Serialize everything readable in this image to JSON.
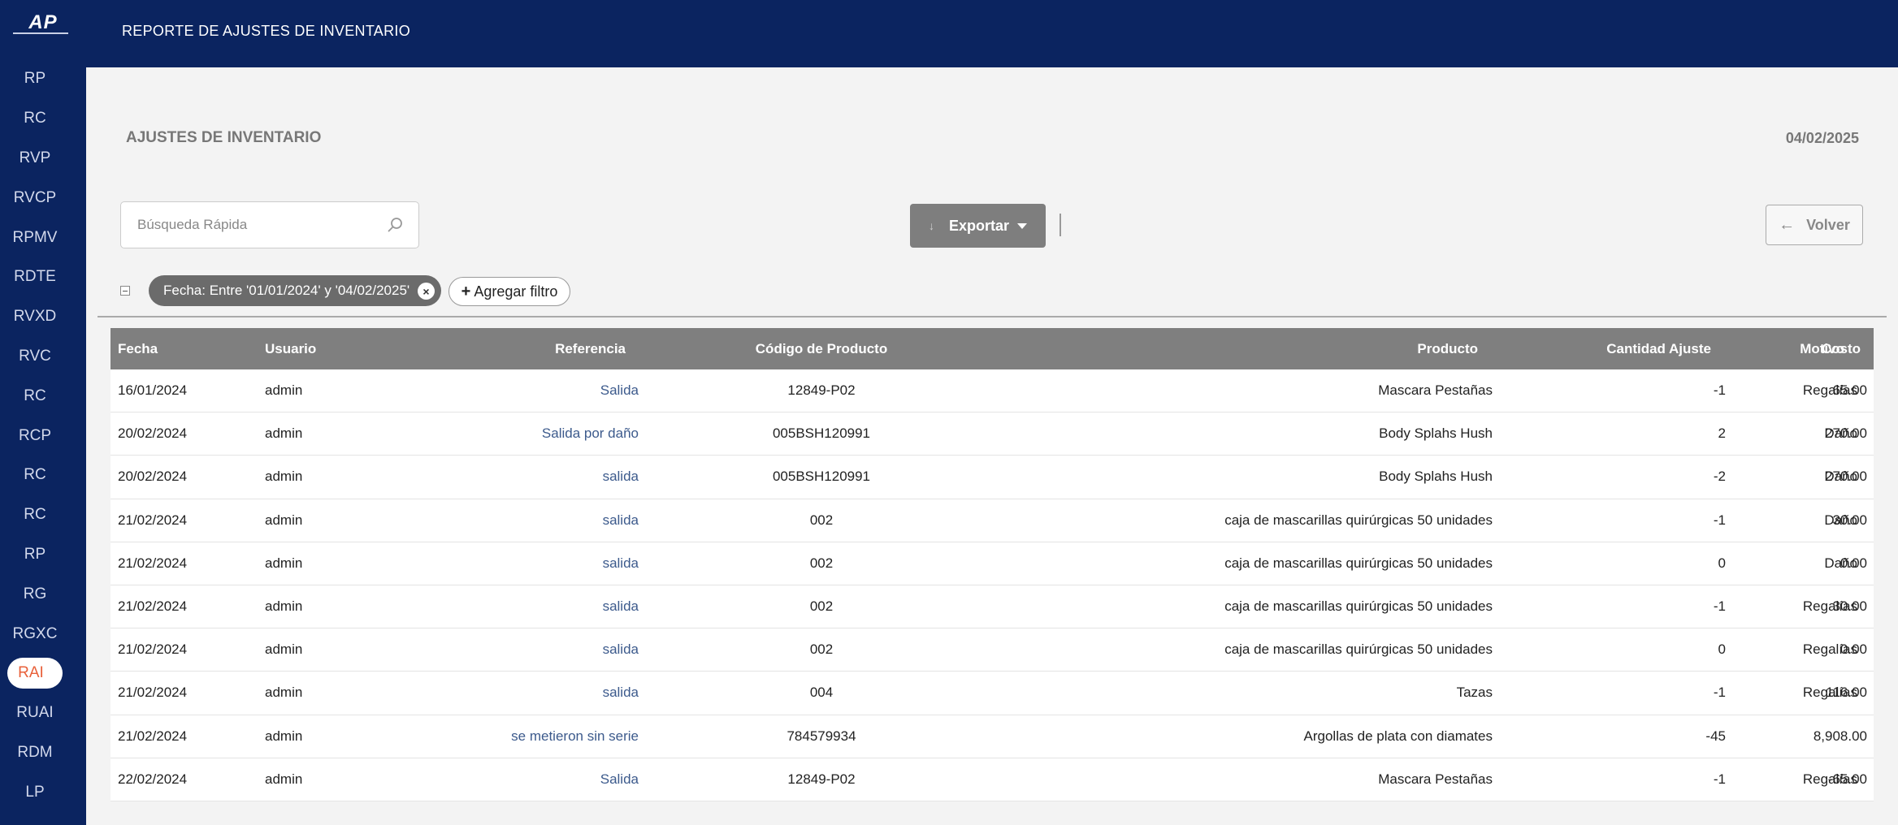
{
  "app": {
    "logo_text": "AP",
    "topbar_title": "REPORTE DE AJUSTES DE INVENTARIO"
  },
  "sidebar": {
    "items": [
      {
        "label": "RP"
      },
      {
        "label": "RC"
      },
      {
        "label": "RVP"
      },
      {
        "label": "RVCP"
      },
      {
        "label": "RPMV"
      },
      {
        "label": "RDTE"
      },
      {
        "label": "RVXD"
      },
      {
        "label": "RVC"
      },
      {
        "label": "RC"
      },
      {
        "label": "RCP"
      },
      {
        "label": "RC"
      },
      {
        "label": "RC"
      },
      {
        "label": "RP"
      },
      {
        "label": "RG"
      },
      {
        "label": "RGXC"
      },
      {
        "label": "RAI",
        "active": true
      },
      {
        "label": "RUAI"
      },
      {
        "label": "RDM"
      },
      {
        "label": "LP"
      }
    ]
  },
  "header": {
    "title": "AJUSTES DE INVENTARIO",
    "date": "04/02/2025"
  },
  "toolbar": {
    "search_placeholder": "Búsqueda Rápida",
    "search_icon": "search-icon",
    "export_label": "Exportar",
    "back_label": "Volver"
  },
  "filters": {
    "chip_label": "Fecha: Entre '01/01/2024' y '04/02/2025'",
    "add_filter_label": "Agregar filtro"
  },
  "table": {
    "columns": [
      "Fecha",
      "Usuario",
      "Referencia",
      "Código de Producto",
      "Producto",
      "Cantidad Ajuste",
      "Motivo",
      "Costo"
    ],
    "rows": [
      [
        "16/01/2024",
        "admin",
        "Salida",
        "12849-P02",
        "Mascara Pestañas",
        "-1",
        "Regalías",
        "65.00"
      ],
      [
        "20/02/2024",
        "admin",
        "Salida por daño",
        "005BSH120991",
        "Body Splahs Hush",
        "2",
        "Daño",
        "270.00"
      ],
      [
        "20/02/2024",
        "admin",
        "salida",
        "005BSH120991",
        "Body Splahs Hush",
        "-2",
        "Daño",
        "270.00"
      ],
      [
        "21/02/2024",
        "admin",
        "salida",
        "002",
        "caja de mascarillas quirúrgicas 50 unidades",
        "-1",
        "Daño",
        "30.00"
      ],
      [
        "21/02/2024",
        "admin",
        "salida",
        "002",
        "caja de mascarillas quirúrgicas 50 unidades",
        "0",
        "Daño",
        "0.00"
      ],
      [
        "21/02/2024",
        "admin",
        "salida",
        "002",
        "caja de mascarillas quirúrgicas 50 unidades",
        "-1",
        "Regalías",
        "30.00"
      ],
      [
        "21/02/2024",
        "admin",
        "salida",
        "002",
        "caja de mascarillas quirúrgicas 50 unidades",
        "0",
        "Regalías",
        "0.00"
      ],
      [
        "21/02/2024",
        "admin",
        "salida",
        "004",
        "Tazas",
        "-1",
        "Regalías",
        "116.00"
      ],
      [
        "21/02/2024",
        "admin",
        "se metieron sin serie",
        "784579934",
        "Argollas de plata con diamates",
        "-45",
        "",
        "8,908.00"
      ],
      [
        "22/02/2024",
        "admin",
        "Salida",
        "12849-P02",
        "Mascara Pestañas",
        "-1",
        "Regalías",
        "-65.00"
      ]
    ]
  },
  "colors": {
    "navy": "#0b2460",
    "active_text": "#e8603a",
    "header_gray": "#7f7f7f",
    "link_blue": "#3c5a8c"
  }
}
